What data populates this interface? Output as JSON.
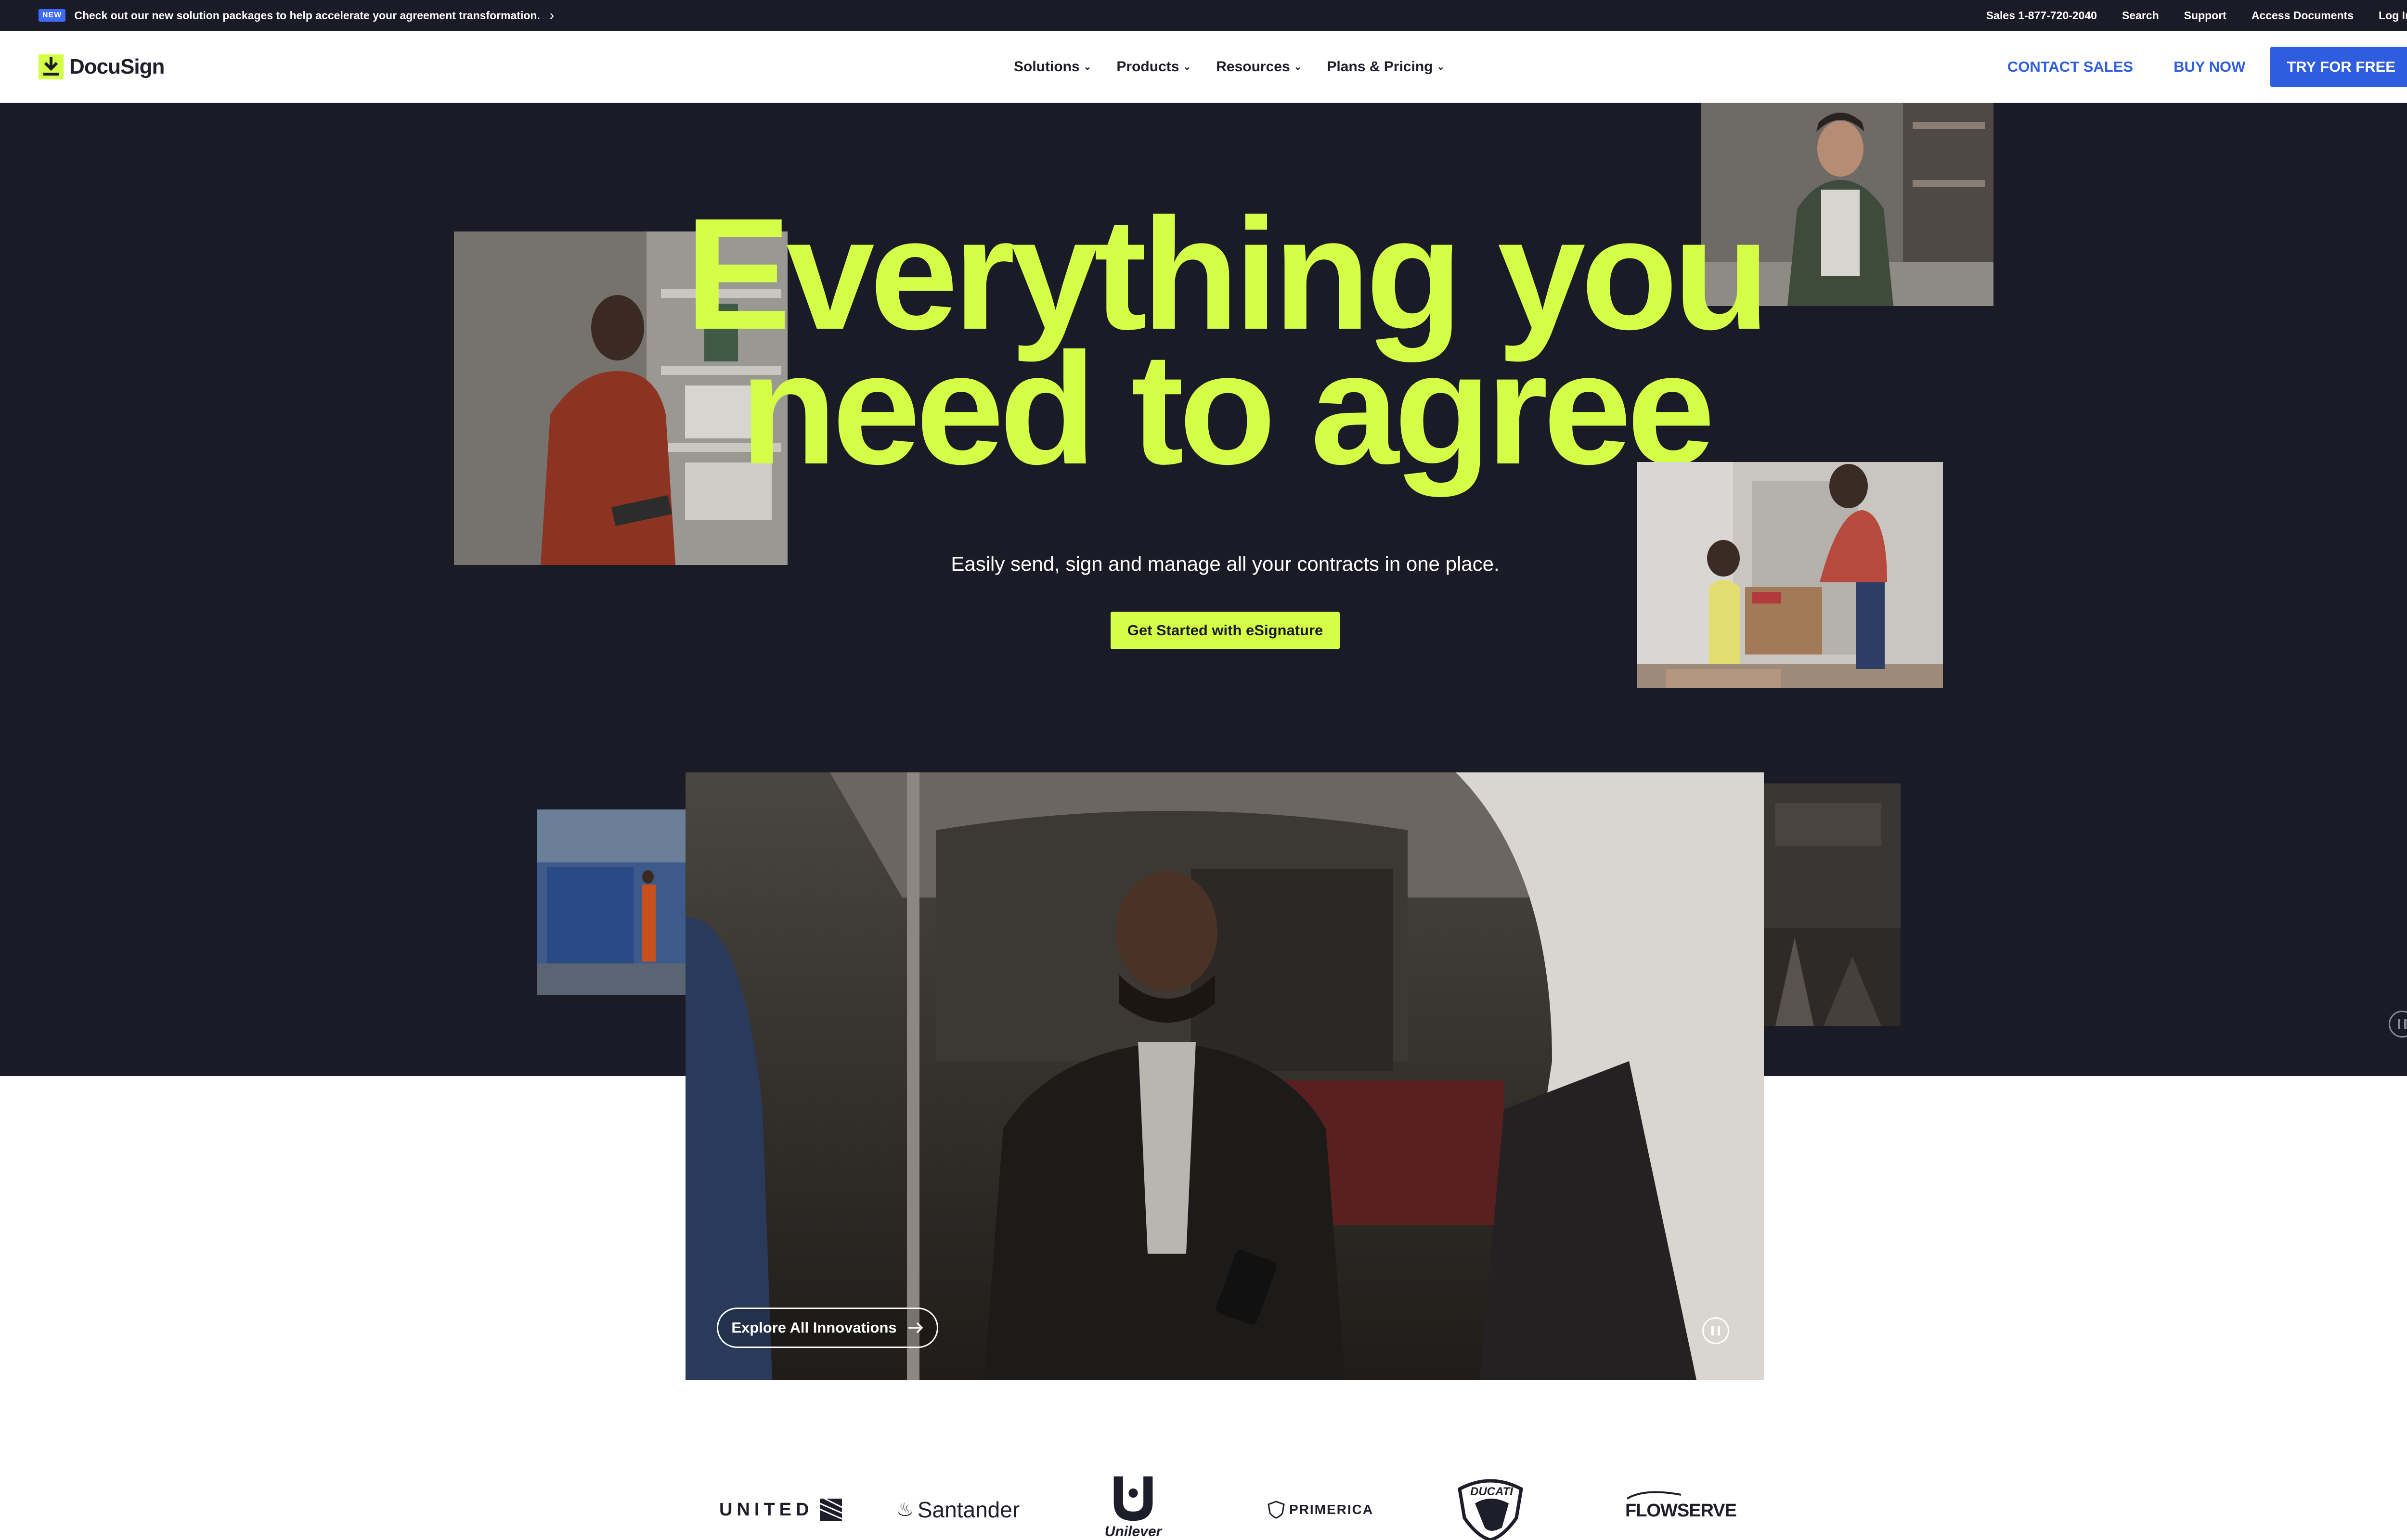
{
  "announcement": {
    "badge": "NEW",
    "text": "Check out our new solution packages to help accelerate your agreement transformation."
  },
  "utility_links": {
    "sales": "Sales 1-877-720-2040",
    "search": "Search",
    "support": "Support",
    "access": "Access Documents",
    "login": "Log In"
  },
  "brand": {
    "name": "DocuSign",
    "accent": "#d5ff47",
    "primary": "#2f5de0",
    "dark": "#1b1a27"
  },
  "nav": {
    "menu": [
      "Solutions",
      "Products",
      "Resources",
      "Plans & Pricing"
    ],
    "contact_sales": "CONTACT SALES",
    "buy_now": "BUY NOW",
    "try_free": "TRY FOR FREE"
  },
  "hero": {
    "headline_line1": "Everything you",
    "headline_line2": "need to agree",
    "subhead": "Easily send, sign and manage all your contracts in one place.",
    "cta": "Get Started with eSignature"
  },
  "video": {
    "explore": "Explore All Innovations"
  },
  "customer_logos": [
    "UNITED",
    "Santander",
    "Unilever",
    "PRIMERICA",
    "DUCATI",
    "FLOWSERVE"
  ]
}
